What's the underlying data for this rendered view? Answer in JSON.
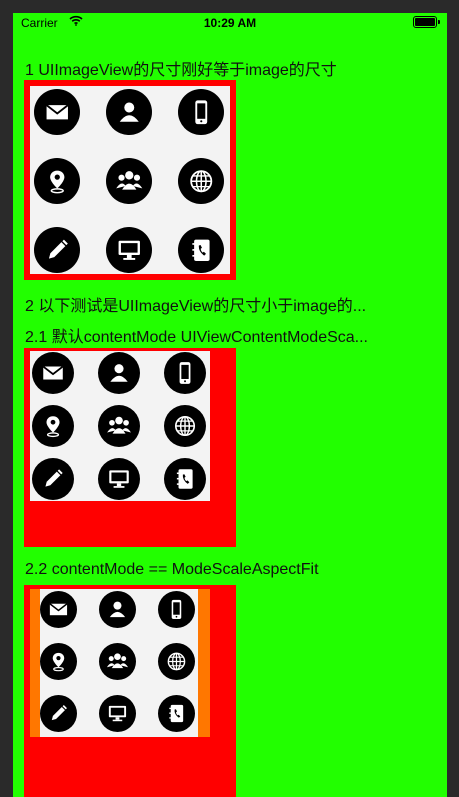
{
  "status_bar": {
    "carrier": "Carrier",
    "time": "10:29 AM"
  },
  "sections": [
    {
      "label": "1 UIImageView的尺寸刚好等于image的尺寸"
    },
    {
      "label": "2 以下测试是UIImageView的尺寸小于image的..."
    },
    {
      "label": "2.1 默认contentMode UIViewContentModeSca..."
    },
    {
      "label": "2.2 contentMode == ModeScaleAspectFit"
    }
  ],
  "icon_grid": [
    "mail-icon",
    "user-icon",
    "phone-icon",
    "location-icon",
    "group-icon",
    "globe-icon",
    "pencil-icon",
    "monitor-icon",
    "contacts-icon"
  ],
  "colors": {
    "background": "#22ff00",
    "frame": "#ff0000",
    "image_bg": "#f3f3f3",
    "orange": "#ff7700"
  }
}
